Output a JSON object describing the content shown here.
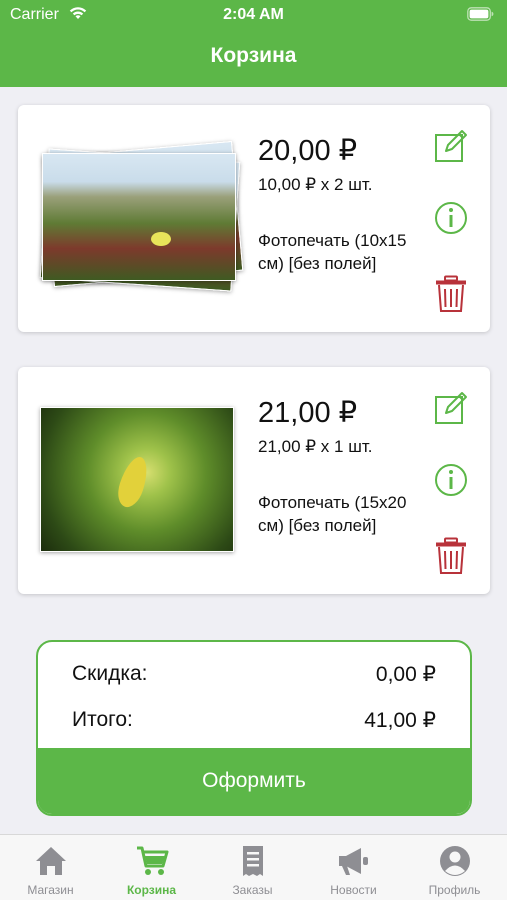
{
  "status_bar": {
    "carrier": "Carrier",
    "time": "2:04 AM"
  },
  "nav": {
    "title": "Корзина"
  },
  "cart_items": [
    {
      "price": "20,00 ₽",
      "quantity": "10,00 ₽ x 2 шт.",
      "description": "Фотопечать (10x15 см) [без полей]"
    },
    {
      "price": "21,00 ₽",
      "quantity": "21,00 ₽ x 1 шт.",
      "description": "Фотопечать (15x20 см) [без полей]"
    }
  ],
  "summary": {
    "discount_label": "Скидка:",
    "discount_value": "0,00 ₽",
    "total_label": "Итого:",
    "total_value": "41,00 ₽",
    "checkout_label": "Оформить"
  },
  "tabs": [
    {
      "label": "Магазин",
      "icon": "home-icon"
    },
    {
      "label": "Корзина",
      "icon": "cart-icon",
      "active": true
    },
    {
      "label": "Заказы",
      "icon": "receipt-icon"
    },
    {
      "label": "Новости",
      "icon": "megaphone-icon"
    },
    {
      "label": "Профиль",
      "icon": "profile-icon"
    }
  ],
  "colors": {
    "accent": "#5cb748",
    "delete": "#b8323a",
    "tab_inactive": "#8e8e93",
    "background": "#efeff4"
  }
}
